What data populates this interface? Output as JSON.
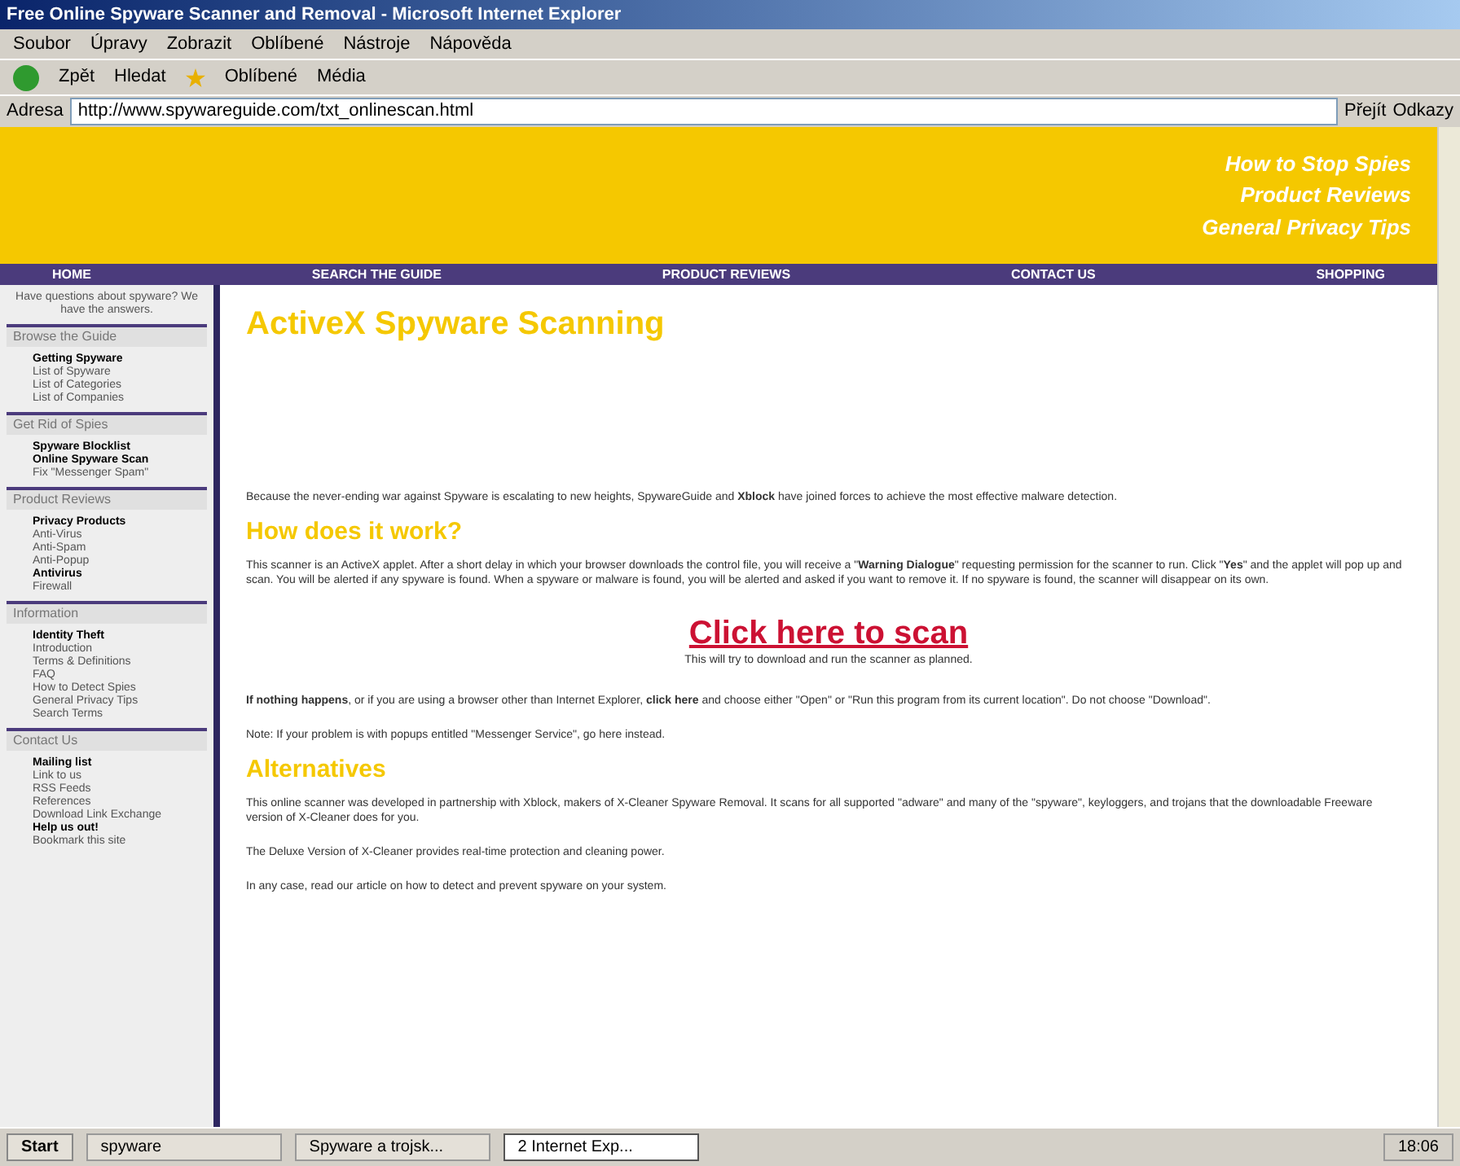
{
  "window": {
    "title": "Free Online Spyware Scanner and Removal - Microsoft Internet Explorer"
  },
  "menu": [
    "Soubor",
    "Úpravy",
    "Zobrazit",
    "Oblíbené",
    "Nástroje",
    "Nápověda"
  ],
  "toolbar": {
    "back": "Zpět",
    "search": "Hledat",
    "favorites": "Oblíbené",
    "media": "Média"
  },
  "address": {
    "label": "Adresa",
    "value": "http://www.spywareguide.com/txt_onlinescan.html",
    "go": "Přejít",
    "links": "Odkazy"
  },
  "banner": {
    "links": [
      "How to Stop Spies",
      "Product Reviews",
      "General Privacy Tips"
    ]
  },
  "nav": [
    "HOME",
    "SEARCH THE GUIDE",
    "PRODUCT REVIEWS",
    "CONTACT US",
    "SHOPPING"
  ],
  "sidebar": {
    "intro": "Have questions about spyware? We have the answers.",
    "sections": [
      {
        "title": "Browse the Guide",
        "items": [
          {
            "label": "Getting Spyware",
            "bold": true
          },
          {
            "label": "List of Spyware",
            "bold": false
          },
          {
            "label": "List of Categories",
            "bold": false
          },
          {
            "label": "List of Companies",
            "bold": false
          }
        ]
      },
      {
        "title": "Get Rid of Spies",
        "items": [
          {
            "label": "Spyware Blocklist",
            "bold": true
          },
          {
            "label": "Online Spyware Scan",
            "bold": true
          },
          {
            "label": "Fix \"Messenger Spam\"",
            "bold": false
          }
        ]
      },
      {
        "title": "Product Reviews",
        "items": [
          {
            "label": "Privacy Products",
            "bold": true
          },
          {
            "label": "Anti-Virus",
            "bold": false
          },
          {
            "label": "Anti-Spam",
            "bold": false
          },
          {
            "label": "Anti-Popup",
            "bold": false
          },
          {
            "label": "Antivirus",
            "bold": true
          },
          {
            "label": "Firewall",
            "bold": false
          }
        ]
      },
      {
        "title": "Information",
        "items": [
          {
            "label": "Identity Theft",
            "bold": true
          },
          {
            "label": "Introduction",
            "bold": false
          },
          {
            "label": "Terms & Definitions",
            "bold": false
          },
          {
            "label": "FAQ",
            "bold": false
          },
          {
            "label": "How to Detect Spies",
            "bold": false
          },
          {
            "label": "General Privacy Tips",
            "bold": false
          },
          {
            "label": "Search Terms",
            "bold": false
          }
        ]
      },
      {
        "title": "Contact Us",
        "items": [
          {
            "label": "Mailing list",
            "bold": true
          },
          {
            "label": "Link to us",
            "bold": false
          },
          {
            "label": "RSS Feeds",
            "bold": false
          },
          {
            "label": "References",
            "bold": false
          },
          {
            "label": "Download Link Exchange",
            "bold": false
          },
          {
            "label": "Help us out!",
            "bold": true
          },
          {
            "label": "Bookmark this site",
            "bold": false
          }
        ]
      }
    ]
  },
  "content": {
    "title": "ActiveX Spyware Scanning",
    "intro": "Because the never-ending war against Spyware is escalating to new heights, SpywareGuide and **Xblock** have joined forces to achieve the most effective malware detection.",
    "h2": "How does it work?",
    "how": "This scanner is an ActiveX applet. After a short delay in which your browser downloads the control file, you will receive a \"**Warning Dialogue**\" requesting permission for the scanner to run. Click \"**Yes**\" and the applet will pop up and scan. You will be alerted if any spyware is found. When a spyware or malware is found, you will be alerted and asked if you want to remove it. If no spyware is found, the scanner will disappear on its own.",
    "scan": "Click here to scan",
    "scan_note": "This will try to download and run the scanner as planned.",
    "nothing": "**If nothing happens**, or if you are using a browser other than Internet Explorer, **click here** and choose either \"Open\" or \"Run this program from its current location\". Do not choose \"Download\".",
    "note": "Note: If your problem is with popups entitled \"Messenger Service\", go here instead.",
    "h3": "Alternatives",
    "alt": "This online scanner was developed in partnership with Xblock, makers of X-Cleaner Spyware Removal. It scans for all supported \"adware\" and many of the \"spyware\", keyloggers, and trojans that the downloadable Freeware version of X-Cleaner does for you.",
    "deluxe": "The Deluxe Version of X-Cleaner provides real-time protection and cleaning power.",
    "anycase": "In any case, read our article on how to detect and prevent spyware on your system."
  },
  "taskbar": {
    "start": "Start",
    "tasks": [
      {
        "label": "spyware",
        "selected": false
      },
      {
        "label": "Spyware a trojsk...",
        "selected": false
      },
      {
        "label": "2 Internet Exp...",
        "selected": true
      }
    ],
    "clock": "18:06"
  }
}
